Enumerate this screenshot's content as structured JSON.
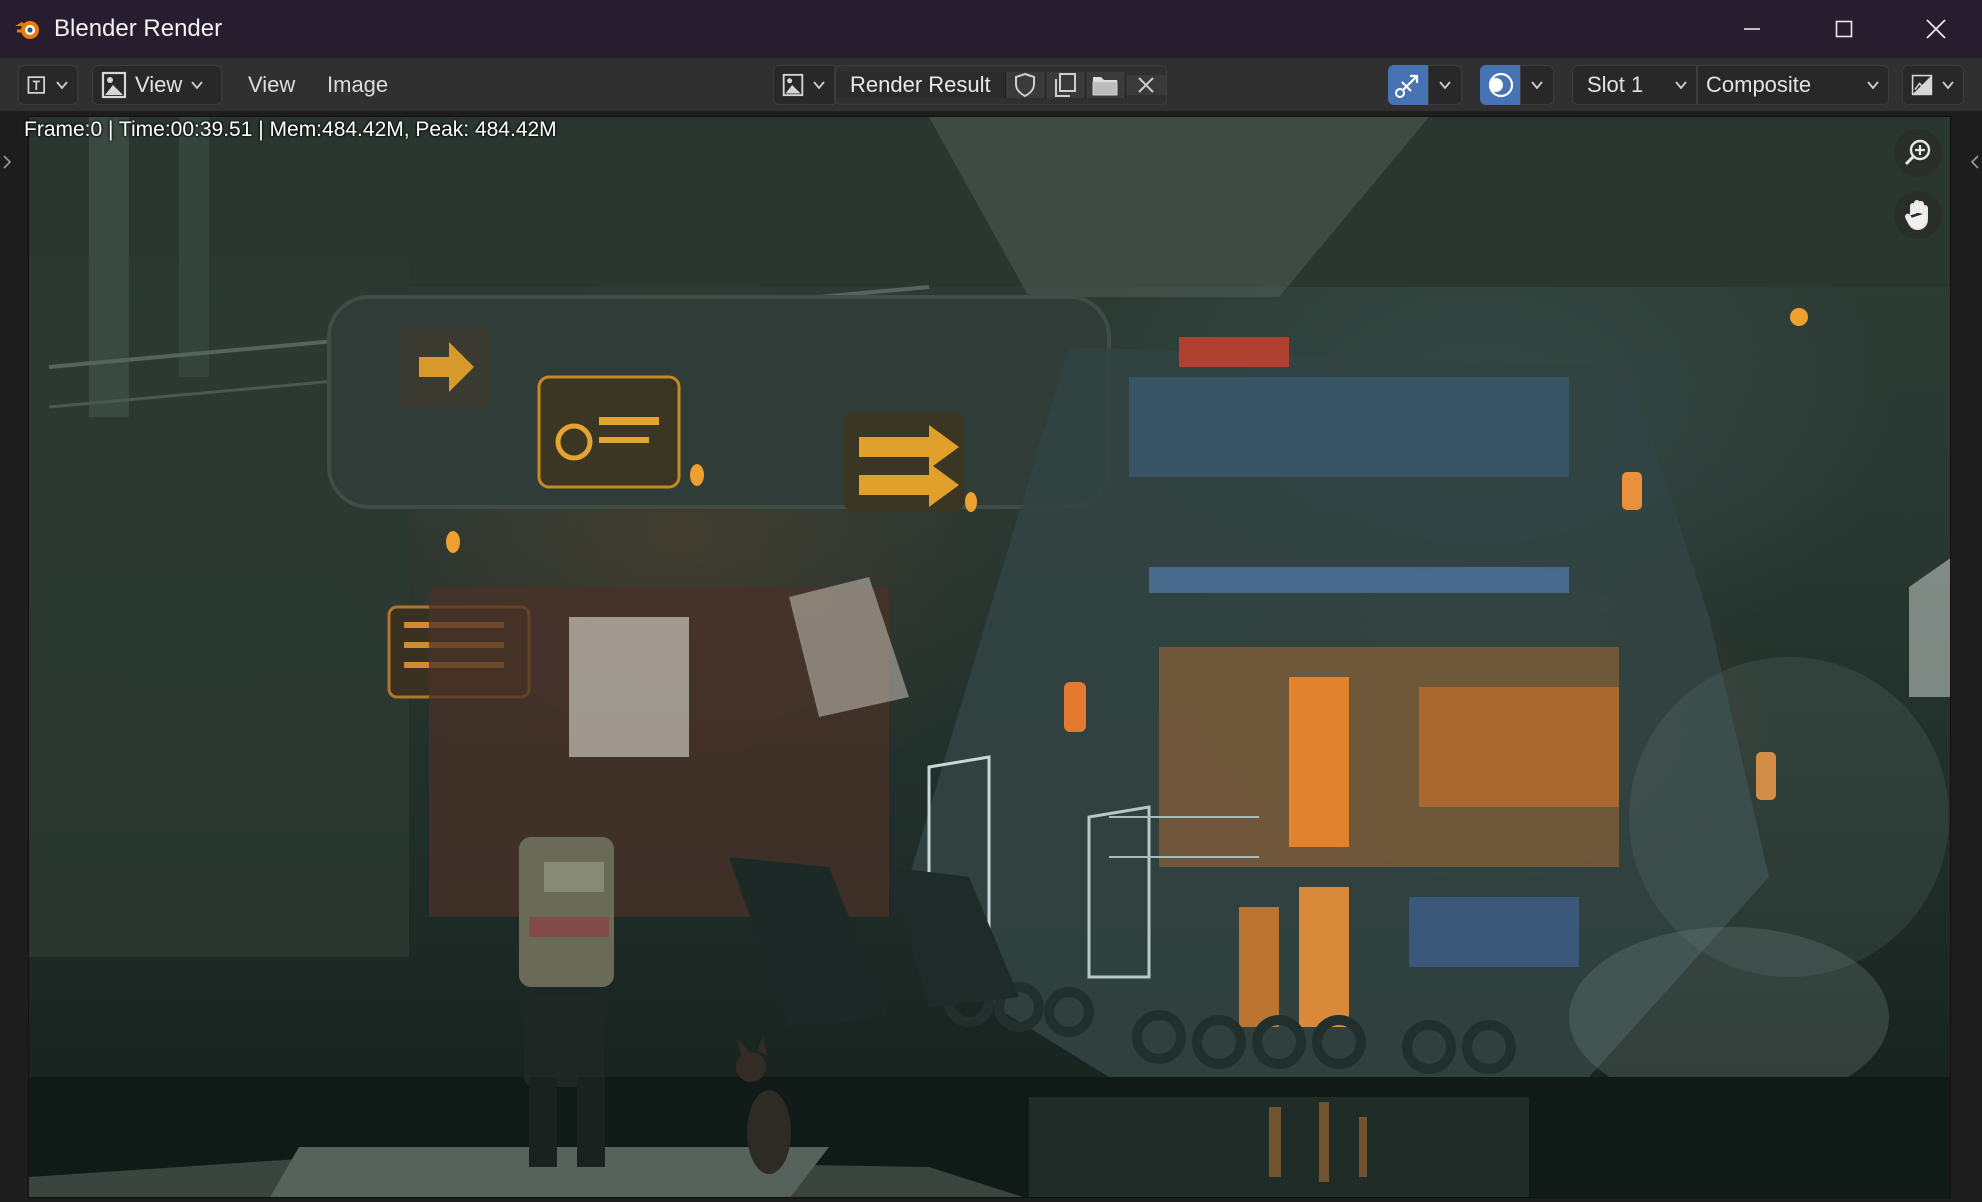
{
  "window": {
    "title": "Blender Render"
  },
  "toolbar": {
    "editor_type_icon": "image-editor-icon",
    "view_dropdown_label": "View",
    "menus": [
      "View",
      "Image"
    ],
    "image_browse_icon": "image-browse-icon",
    "image_name": "Render Result",
    "fake_user_icon": "shield-icon",
    "duplicate_icon": "copy-icon",
    "open_icon": "folder-icon",
    "unlink_icon": "close-icon",
    "gizmo_icon": "gizmo-icon",
    "overlay_icon": "overlay-icon",
    "slot_label": "Slot 1",
    "layer_label": "Composite",
    "display_channels_icon": "display-channels-icon",
    "accent_color": "#4772b3"
  },
  "viewer": {
    "info_text": "Frame:0 | Time:00:39.51 | Mem:484.42M, Peak: 484.42M",
    "zoom_icon": "zoom-icon",
    "pan_icon": "hand-icon",
    "render_description_icon": "render-image"
  }
}
